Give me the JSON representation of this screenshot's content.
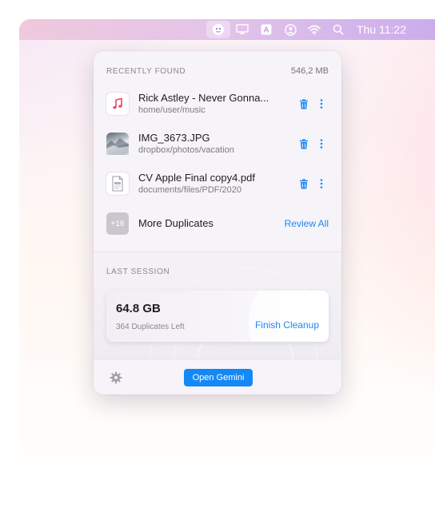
{
  "menubar": {
    "icons": [
      "gemini-app-icon",
      "airplay-icon",
      "input-source-icon",
      "user-account-icon",
      "wifi-icon",
      "spotlight-search-icon"
    ],
    "input_source_letter": "A",
    "clock": "Thu 11:22"
  },
  "recently_found": {
    "title": "RECENTLY FOUND",
    "size": "546,2 MB",
    "files": [
      {
        "name": "Rick Astley - Never Gonna...",
        "path": "home/user/music",
        "icon": "music-note-icon"
      },
      {
        "name": "IMG_3673.JPG",
        "path": "dropbox/photos/vacation",
        "icon": "photo-thumbnail"
      },
      {
        "name": "CV Apple Final copy4.pdf",
        "path": "documents/files/PDF/2020",
        "icon": "pdf-icon"
      }
    ],
    "more": {
      "badge": "+16",
      "label": "More Duplicates",
      "action": "Review All"
    }
  },
  "last_session": {
    "title": "LAST SESSION",
    "size": "64.8 GB",
    "subtitle": "364 Duplicates Left",
    "action": "Finish Cleanup"
  },
  "footer": {
    "button": "Open Gemini"
  },
  "colors": {
    "accent": "#1f87f5",
    "button": "#1489f5",
    "menubar_start": "#efc9dc",
    "menubar_end": "#c8a9ec"
  }
}
